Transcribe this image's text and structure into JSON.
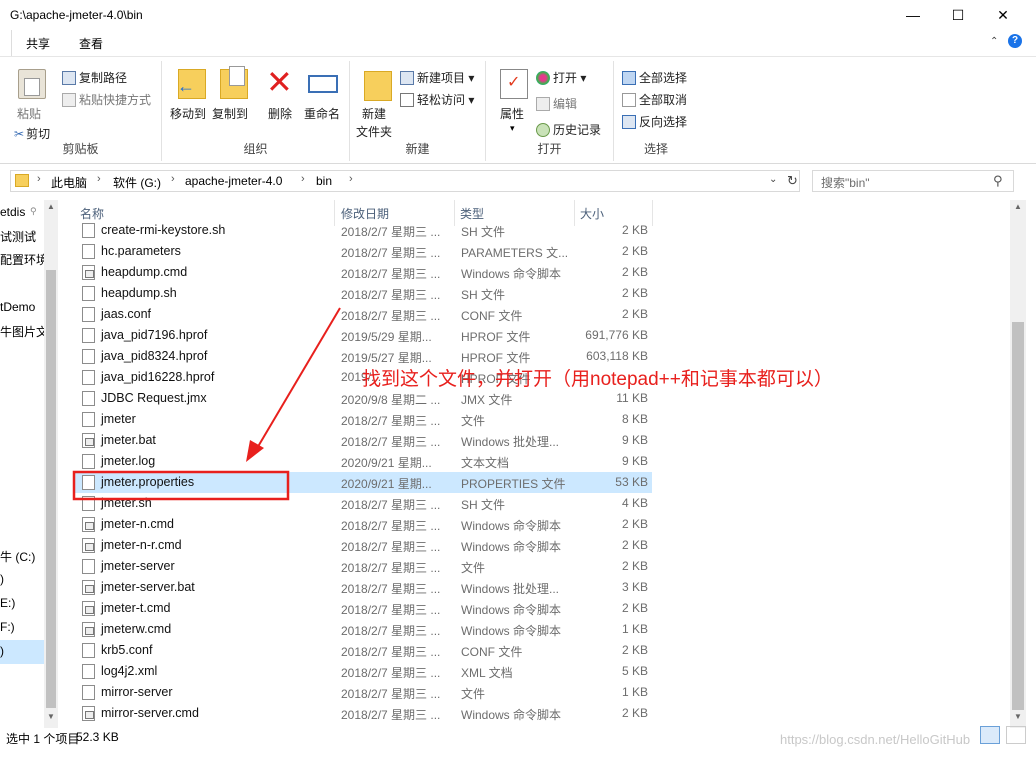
{
  "window": {
    "title": "G:\\apache-jmeter-4.0\\bin"
  },
  "tabs": [
    "共享",
    "查看"
  ],
  "ribbon": {
    "clipboard": {
      "label": "剪贴板",
      "paste": "粘贴",
      "copy_path": "复制路径",
      "paste_shortcut": "粘贴快捷方式",
      "cut": "剪切"
    },
    "organize": {
      "label": "组织",
      "move_to": "移动到",
      "copy_to": "复制到",
      "delete": "删除",
      "rename": "重命名"
    },
    "new": {
      "label": "新建",
      "new_folder_l1": "新建",
      "new_folder_l2": "文件夹",
      "new_item": "新建项目",
      "easy_access": "轻松访问"
    },
    "open": {
      "label": "打开",
      "properties": "属性",
      "open": "打开",
      "edit": "编辑",
      "history": "历史记录"
    },
    "select": {
      "label": "选择",
      "select_all": "全部选择",
      "select_none": "全部取消",
      "invert": "反向选择"
    }
  },
  "address": {
    "crumbs": [
      "此电脑",
      "软件 (G:)",
      "apache-jmeter-4.0",
      "bin"
    ],
    "search_placeholder": "搜索\"bin\""
  },
  "nav": [
    "etdis",
    "试测试",
    "配置环境",
    "tDemo",
    "牛图片文",
    "牛 (C:)",
    ")",
    "E:)",
    "F:)",
    ")"
  ],
  "columns": {
    "name": "名称",
    "date": "修改日期",
    "type": "类型",
    "size": "大小"
  },
  "files": [
    {
      "name": "create-rmi-keystore.sh",
      "date": "2018/2/7 星期三 ...",
      "type": "SH 文件",
      "size": "2 KB",
      "icon": "file"
    },
    {
      "name": "hc.parameters",
      "date": "2018/2/7 星期三 ...",
      "type": "PARAMETERS 文...",
      "size": "2 KB",
      "icon": "file"
    },
    {
      "name": "heapdump.cmd",
      "date": "2018/2/7 星期三 ...",
      "type": "Windows 命令脚本",
      "size": "2 KB",
      "icon": "cmd"
    },
    {
      "name": "heapdump.sh",
      "date": "2018/2/7 星期三 ...",
      "type": "SH 文件",
      "size": "2 KB",
      "icon": "file"
    },
    {
      "name": "jaas.conf",
      "date": "2018/2/7 星期三 ...",
      "type": "CONF 文件",
      "size": "2 KB",
      "icon": "file"
    },
    {
      "name": "java_pid7196.hprof",
      "date": "2019/5/29 星期...",
      "type": "HPROF 文件",
      "size": "691,776 KB",
      "icon": "file"
    },
    {
      "name": "java_pid8324.hprof",
      "date": "2019/5/27 星期...",
      "type": "HPROF 文件",
      "size": "603,118 KB",
      "icon": "file"
    },
    {
      "name": "java_pid16228.hprof",
      "date": "2019/...",
      "type": "HPROF 文件",
      "size": "",
      "icon": "file"
    },
    {
      "name": "JDBC Request.jmx",
      "date": "2020/9/8 星期二 ...",
      "type": "JMX 文件",
      "size": "11 KB",
      "icon": "file"
    },
    {
      "name": "jmeter",
      "date": "2018/2/7 星期三 ...",
      "type": "文件",
      "size": "8 KB",
      "icon": "file"
    },
    {
      "name": "jmeter.bat",
      "date": "2018/2/7 星期三 ...",
      "type": "Windows 批处理...",
      "size": "9 KB",
      "icon": "cmd"
    },
    {
      "name": "jmeter.log",
      "date": "2020/9/21 星期...",
      "type": "文本文档",
      "size": "9 KB",
      "icon": "file"
    },
    {
      "name": "jmeter.properties",
      "date": "2020/9/21 星期...",
      "type": "PROPERTIES 文件",
      "size": "53 KB",
      "icon": "file",
      "selected": true
    },
    {
      "name": "jmeter.sh",
      "date": "2018/2/7 星期三 ...",
      "type": "SH 文件",
      "size": "4 KB",
      "icon": "file"
    },
    {
      "name": "jmeter-n.cmd",
      "date": "2018/2/7 星期三 ...",
      "type": "Windows 命令脚本",
      "size": "2 KB",
      "icon": "cmd"
    },
    {
      "name": "jmeter-n-r.cmd",
      "date": "2018/2/7 星期三 ...",
      "type": "Windows 命令脚本",
      "size": "2 KB",
      "icon": "cmd"
    },
    {
      "name": "jmeter-server",
      "date": "2018/2/7 星期三 ...",
      "type": "文件",
      "size": "2 KB",
      "icon": "file"
    },
    {
      "name": "jmeter-server.bat",
      "date": "2018/2/7 星期三 ...",
      "type": "Windows 批处理...",
      "size": "3 KB",
      "icon": "cmd"
    },
    {
      "name": "jmeter-t.cmd",
      "date": "2018/2/7 星期三 ...",
      "type": "Windows 命令脚本",
      "size": "2 KB",
      "icon": "cmd"
    },
    {
      "name": "jmeterw.cmd",
      "date": "2018/2/7 星期三 ...",
      "type": "Windows 命令脚本",
      "size": "1 KB",
      "icon": "cmd"
    },
    {
      "name": "krb5.conf",
      "date": "2018/2/7 星期三 ...",
      "type": "CONF 文件",
      "size": "2 KB",
      "icon": "file"
    },
    {
      "name": "log4j2.xml",
      "date": "2018/2/7 星期三 ...",
      "type": "XML 文档",
      "size": "5 KB",
      "icon": "file"
    },
    {
      "name": "mirror-server",
      "date": "2018/2/7 星期三 ...",
      "type": "文件",
      "size": "1 KB",
      "icon": "file"
    },
    {
      "name": "mirror-server.cmd",
      "date": "2018/2/7 星期三 ...",
      "type": "Windows 命令脚本",
      "size": "2 KB",
      "icon": "cmd"
    }
  ],
  "annotation": {
    "text": "找到这个文件，并打开（用notepad++和记事本都可以）",
    "color": "#e8201d"
  },
  "status": {
    "selected": "选中 1 个项目",
    "size": "52.3 KB"
  },
  "watermark": "https://blog.csdn.net/HelloGitHub"
}
